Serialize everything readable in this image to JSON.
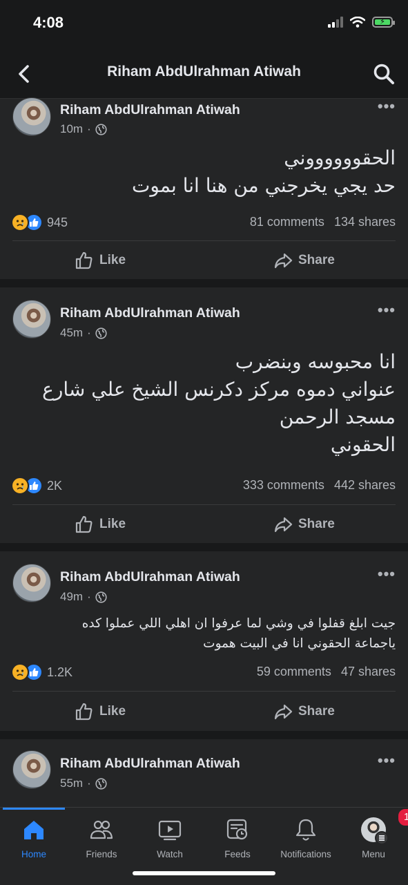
{
  "status_bar": {
    "time": "4:08"
  },
  "header": {
    "title": "Riham AbdUlrahman Atiwah"
  },
  "posts": [
    {
      "author": "Riham AbdUlrahman Atiwah",
      "time": "10m",
      "text_lines": [
        "الحقووووووني",
        "حد يجي يخرجني من هنا انا بموت"
      ],
      "reactions": "945",
      "comments": "81 comments",
      "shares": "134 shares",
      "like_label": "Like",
      "share_label": "Share"
    },
    {
      "author": "Riham AbdUlrahman Atiwah",
      "time": "45m",
      "text_lines": [
        "انا محبوسه وبنضرب",
        "عنواني دموه مركز دكرنس  الشيخ علي شارع",
        "مسجد الرحمن",
        "الحقوني"
      ],
      "reactions": "2K",
      "comments": "333 comments",
      "shares": "442 shares",
      "like_label": "Like",
      "share_label": "Share"
    },
    {
      "author": "Riham AbdUlrahman Atiwah",
      "time": "49m",
      "text_lines": [
        "جيت ابلغ قفلوا في وشي لما عرفوا ان اهلي اللي عملوا كده",
        "ياجماعة الحقوني انا في البيت هموت"
      ],
      "reactions": "1.2K",
      "comments": "59 comments",
      "shares": "47 shares",
      "like_label": "Like",
      "share_label": "Share"
    },
    {
      "author": "Riham AbdUlrahman Atiwah",
      "time": "55m"
    }
  ],
  "tabbar": {
    "home": "Home",
    "friends": "Friends",
    "watch": "Watch",
    "feeds": "Feeds",
    "notifications": "Notifications",
    "menu": "Menu",
    "menu_badge": "1"
  },
  "colors": {
    "accent": "#2d88ff",
    "background": "#18191a",
    "card": "#242526",
    "badge": "#e41e3f"
  }
}
